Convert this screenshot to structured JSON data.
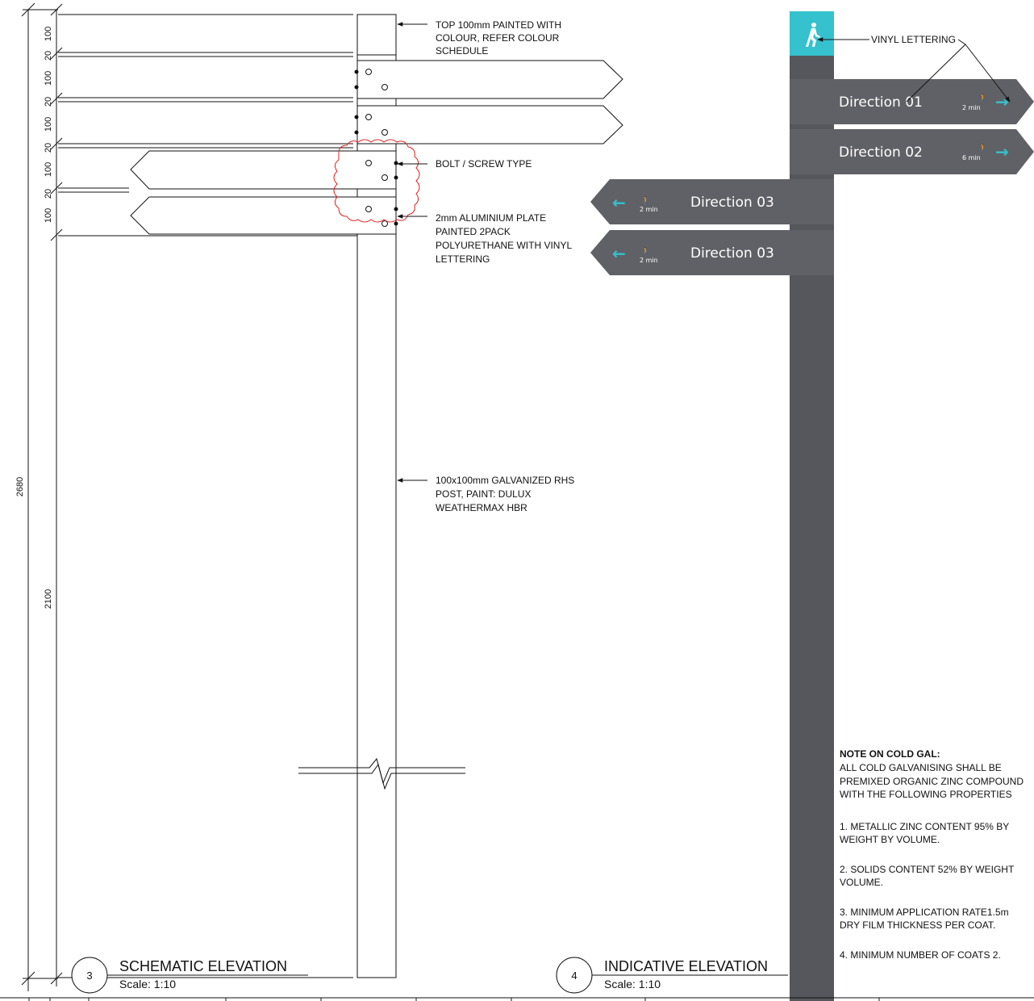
{
  "colors": {
    "post": "#55575c",
    "sign_panel": "#606166",
    "accent": "#35c1cd",
    "revision_cloud": "#e02020",
    "line": "#111111"
  },
  "dimensions": {
    "d1": "100",
    "d2": "20",
    "d3": "100",
    "d4": "20",
    "d5": "100",
    "d6": "20",
    "d7": "100",
    "d8": "20",
    "d9": "100",
    "overall": "2680",
    "post_height": "2100"
  },
  "annotations": {
    "top": [
      "TOP 100mm PAINTED WITH",
      "COLOUR, REFER COLOUR",
      "SCHEDULE"
    ],
    "bolt": "BOLT / SCREW TYPE",
    "plate": [
      "2mm ALUMINIUM PLATE",
      "PAINTED 2PACK",
      "POLYURETHANE WITH VINYL",
      "LETTERING"
    ],
    "post": [
      "100x100mm GALVANIZED RHS",
      "POST, PAINT: DULUX",
      "WEATHERMAX HBR"
    ],
    "vinyl": "VINYL LETTERING"
  },
  "signs": [
    {
      "label": "Direction 01",
      "time": "2 min",
      "arrow": "→",
      "walker": "🚶"
    },
    {
      "label": "Direction 02",
      "time": "6 min",
      "arrow": "→",
      "walker": "🚶"
    },
    {
      "label": "Direction 03",
      "time": "2 min",
      "arrow": "←",
      "walker": "🚶"
    },
    {
      "label": "Direction 03",
      "time": "2 min",
      "arrow": "←",
      "walker": "🚶"
    }
  ],
  "header_icon": "walking-person-icon",
  "notes": {
    "heading": "NOTE ON COLD GAL:",
    "intro": [
      "ALL COLD GALVANISING SHALL BE",
      "PREMIXED ORGANIC ZINC COMPOUND",
      "WITH THE FOLLOWING PROPERTIES"
    ],
    "n1": [
      "1. METALLIC ZINC CONTENT 95% BY",
      "WEIGHT BY VOLUME."
    ],
    "n2": [
      "2. SOLIDS CONTENT 52% BY WEIGHT",
      "VOLUME."
    ],
    "n3": [
      "3. MINIMUM APPLICATION RATE1.5m",
      "DRY FILM THICKNESS PER COAT."
    ],
    "n4": "4. MINIMUM NUMBER OF COATS 2."
  },
  "views": [
    {
      "number": "3",
      "title": "SCHEMATIC ELEVATION",
      "scale": "Scale: 1:10"
    },
    {
      "number": "4",
      "title": "INDICATIVE ELEVATION",
      "scale": "Scale: 1:10"
    }
  ]
}
